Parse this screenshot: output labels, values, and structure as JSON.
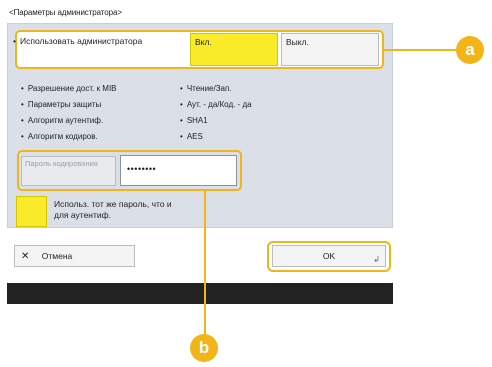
{
  "screen_title": "<Параметры администратора>",
  "admin_setting": {
    "label": "Использовать администратора",
    "on_label": "Вкл.",
    "off_label": "Выкл."
  },
  "info_rows": [
    {
      "label": "Разрешение дост. к MIB",
      "value": "Чтение/Зап."
    },
    {
      "label": "Параметры защиты",
      "value": "Аут. - да/Код. - да"
    },
    {
      "label": "Алгоритм аутентиф.",
      "value": "SHA1"
    },
    {
      "label": "Алгоритм кодиров.",
      "value": "AES"
    }
  ],
  "password": {
    "label": "Пароль кодирования",
    "value": "••••••••"
  },
  "same_password_checkbox_label": "Использ. тот же пароль, что и для аутентиф.",
  "buttons": {
    "cancel_label": "Отмена",
    "ok_label": "OK"
  },
  "callouts": [
    "a",
    "b"
  ],
  "colors": {
    "highlight": "#f2b417",
    "selected_button": "#f9eb2a",
    "panel_background": "#dbe0e8",
    "footer_bar": "#222222"
  },
  "icons": {
    "cancel": "close-icon",
    "ok": "enter-icon"
  }
}
